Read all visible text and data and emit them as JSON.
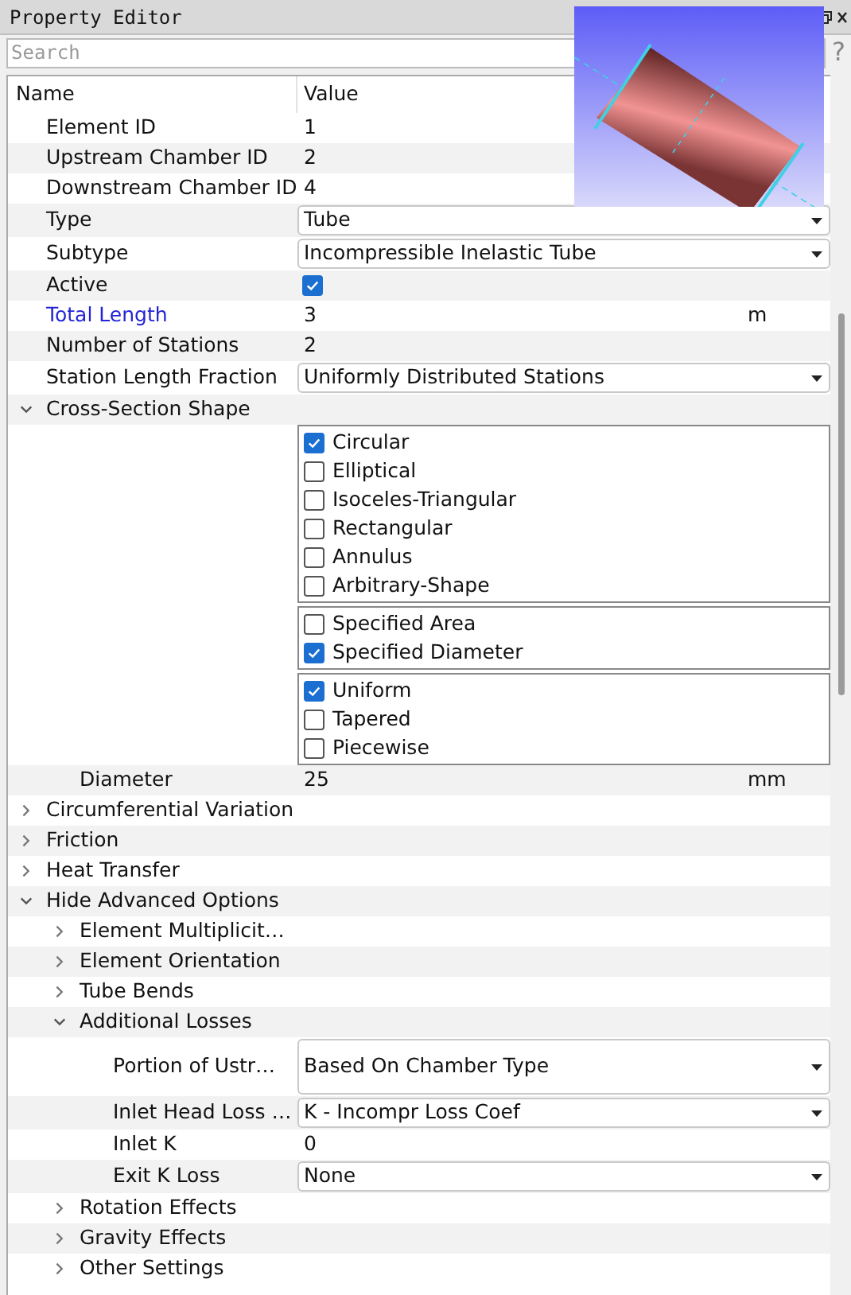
{
  "window": {
    "title": "Property Editor"
  },
  "search": {
    "placeholder": "Search",
    "help": "?"
  },
  "columns": [
    "Name",
    "Value"
  ],
  "rows": [
    {
      "kind": "field",
      "label": "Element ID",
      "value": "1"
    },
    {
      "kind": "field",
      "label": "Upstream Chamber ID",
      "value": "2"
    },
    {
      "kind": "field",
      "label": "Downstream Chamber ID",
      "value": "4"
    },
    {
      "kind": "combo",
      "label": "Type",
      "value": "Tube"
    },
    {
      "kind": "combo",
      "label": "Subtype",
      "value": "Incompressible Inelastic Tube"
    },
    {
      "kind": "checkbox",
      "label": "Active",
      "checked": true
    },
    {
      "kind": "field",
      "label": "Total Length",
      "value": "3",
      "unit": "m",
      "modified": true
    },
    {
      "kind": "field",
      "label": "Number of Stations",
      "value": "2"
    },
    {
      "kind": "combo",
      "label": "Station Length Fraction",
      "value": "Uniformly Distributed Stations"
    },
    {
      "kind": "group",
      "label": "Cross-Section Shape",
      "expanded": true,
      "children": [
        {
          "kind": "options",
          "groups": [
            [
              {
                "label": "Circular",
                "checked": true
              },
              {
                "label": "Elliptical",
                "checked": false
              },
              {
                "label": "Isoceles-Triangular",
                "checked": false
              },
              {
                "label": "Rectangular",
                "checked": false
              },
              {
                "label": "Annulus",
                "checked": false
              },
              {
                "label": "Arbitrary-Shape",
                "checked": false
              }
            ],
            [
              {
                "label": "Specified Area",
                "checked": false
              },
              {
                "label": "Specified Diameter",
                "checked": true
              }
            ],
            [
              {
                "label": "Uniform",
                "checked": true
              },
              {
                "label": "Tapered",
                "checked": false
              },
              {
                "label": "Piecewise",
                "checked": false
              }
            ]
          ]
        },
        {
          "kind": "field",
          "label": "Diameter",
          "value": "25",
          "unit": "mm"
        }
      ]
    },
    {
      "kind": "group",
      "label": "Circumferential Variation",
      "expanded": false
    },
    {
      "kind": "group",
      "label": "Friction",
      "expanded": false
    },
    {
      "kind": "group",
      "label": "Heat Transfer",
      "expanded": false
    },
    {
      "kind": "group",
      "label": "Hide Advanced Options",
      "expanded": true,
      "children": [
        {
          "kind": "group",
          "label": "Element Multiplicit…",
          "expanded": false
        },
        {
          "kind": "group",
          "label": "Element Orientation",
          "expanded": false
        },
        {
          "kind": "group",
          "label": "Tube Bends",
          "expanded": false
        },
        {
          "kind": "group",
          "label": "Additional Losses",
          "expanded": true,
          "children": [
            {
              "kind": "combo",
              "label": "Portion of Ustr…",
              "value": "Based On Chamber Type",
              "tall": true
            },
            {
              "kind": "combo",
              "label": "Inlet Head Loss …",
              "value": "K - Incompr Loss Coef"
            },
            {
              "kind": "field",
              "label": "Inlet K",
              "value": "0"
            },
            {
              "kind": "combo",
              "label": "Exit K Loss",
              "value": "None"
            }
          ]
        },
        {
          "kind": "group",
          "label": "Rotation Effects",
          "expanded": false
        },
        {
          "kind": "group",
          "label": "Gravity Effects",
          "expanded": false
        },
        {
          "kind": "group",
          "label": "Other Settings",
          "expanded": false
        }
      ]
    }
  ]
}
